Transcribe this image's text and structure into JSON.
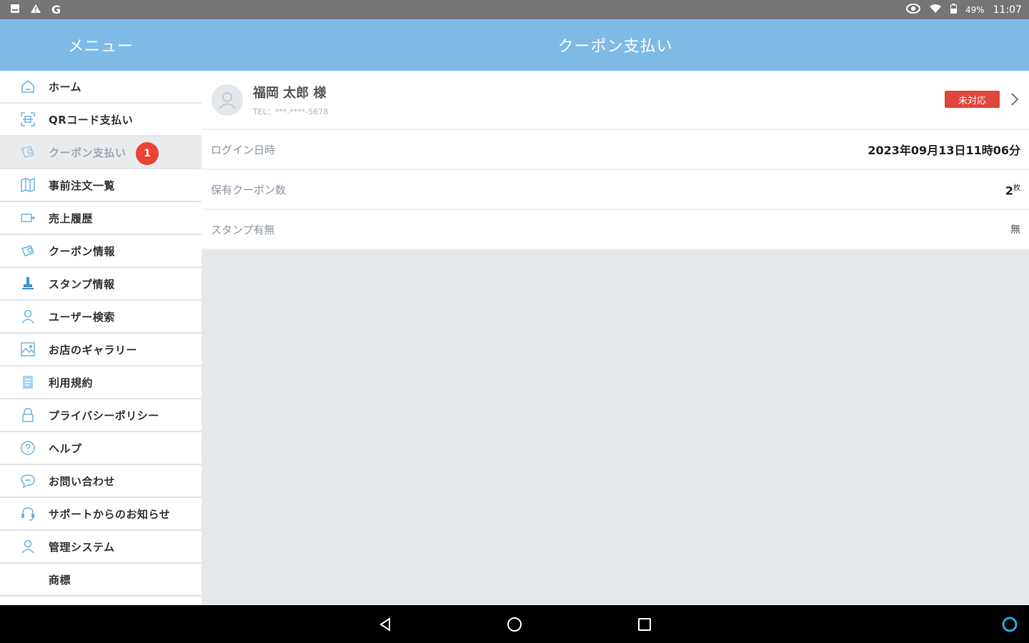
{
  "status_bar": {
    "left_icons": [
      "image-icon",
      "warning-icon",
      "google-icon"
    ],
    "right_icons": [
      "eye-icon",
      "wifi-icon",
      "battery-icon"
    ],
    "battery": "49%",
    "time": "11:07"
  },
  "header": {
    "menu_label": "メニュー",
    "title": "クーポン支払い"
  },
  "sidebar": {
    "items": [
      {
        "label": "ホーム",
        "icon": "home-icon"
      },
      {
        "label": "QRコード支払い",
        "icon": "qr-scan-icon"
      },
      {
        "label": "クーポン支払い",
        "icon": "coupon-icon",
        "badge": "1",
        "active": true
      },
      {
        "label": "事前注文一覧",
        "icon": "map-icon"
      },
      {
        "label": "売上履歴",
        "icon": "sales-icon"
      },
      {
        "label": "クーポン情報",
        "icon": "coupon-info-icon"
      },
      {
        "label": "スタンプ情報",
        "icon": "stamp-icon"
      },
      {
        "label": "ユーザー検索",
        "icon": "user-search-icon"
      },
      {
        "label": "お店のギャラリー",
        "icon": "gallery-icon"
      },
      {
        "label": "利用規約",
        "icon": "document-icon"
      },
      {
        "label": "プライバシーポリシー",
        "icon": "lock-icon"
      },
      {
        "label": "ヘルプ",
        "icon": "help-icon"
      },
      {
        "label": "お問い合わせ",
        "icon": "chat-icon"
      },
      {
        "label": "サポートからのお知らせ",
        "icon": "headset-icon"
      },
      {
        "label": "管理システム",
        "icon": "admin-user-icon"
      },
      {
        "label": "商標",
        "icon": ""
      }
    ]
  },
  "user": {
    "name": "福岡 太郎 様",
    "tel": "TEL：***-****-5678",
    "status": "未対応"
  },
  "details": [
    {
      "label": "ログイン日時",
      "value": "2023年09月13日11時06分"
    },
    {
      "label": "保有クーポン数",
      "value": "2",
      "unit": "枚"
    },
    {
      "label": "スタンプ有無",
      "value": "無"
    }
  ],
  "colors": {
    "header": "#7dbbe6",
    "status_badge": "#e0463b",
    "notification_badge": "#ea4335",
    "icon": "#6fb3e0"
  }
}
